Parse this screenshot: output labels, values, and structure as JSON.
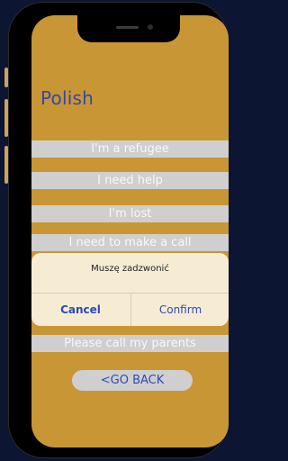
{
  "screen": {
    "title": "Polish",
    "phrases": [
      "I'm a refugee",
      "I need help",
      "I'm lost",
      "I need to make a call",
      "",
      "Please call my parents"
    ],
    "back_label": "<GO BACK"
  },
  "dialog": {
    "message": "Muszę zadzwonić",
    "cancel_label": "Cancel",
    "confirm_label": "Confirm"
  },
  "colors": {
    "screen_background": "#c99636",
    "accent_blue": "#2d4ab5",
    "phrase_background": "#cfcfcf",
    "dialog_background": "#f6ecd4"
  }
}
